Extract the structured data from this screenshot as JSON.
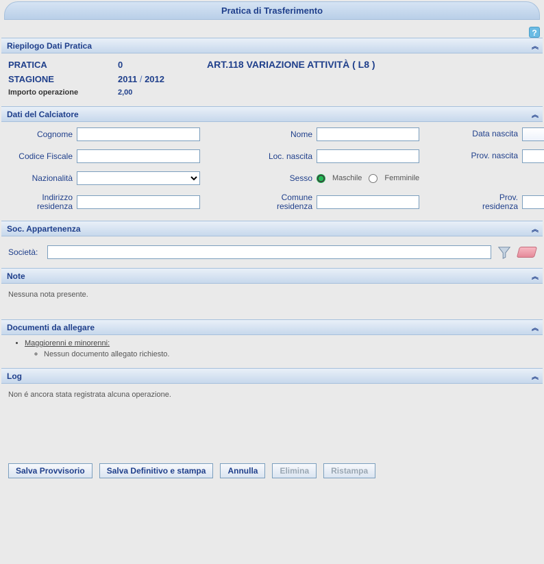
{
  "page_title": "Pratica di Trasferimento",
  "help_label": "?",
  "sections": {
    "riepilogo": {
      "title": "Riepilogo Dati Pratica"
    },
    "calciatore": {
      "title": "Dati del Calciatore"
    },
    "societa": {
      "title": "Soc. Appartenenza"
    },
    "note": {
      "title": "Note"
    },
    "documenti": {
      "title": "Documenti da allegare"
    },
    "log": {
      "title": "Log"
    }
  },
  "summary": {
    "pratica_label": "PRATICA",
    "pratica_value": "0",
    "art_label": "ART.118 VARIAZIONE ATTIVITÀ  ( L8 )",
    "stagione_label": "STAGIONE",
    "stagione_start": "2011",
    "stagione_sep": "/",
    "stagione_end": "2012",
    "importo_label": "Importo operazione",
    "importo_value": "2,00"
  },
  "calciatore": {
    "cognome_label": "Cognome",
    "nome_label": "Nome",
    "data_nascita_label": "Data nascita",
    "codice_fiscale_label": "Codice Fiscale",
    "loc_nascita_label": "Loc. nascita",
    "prov_nascita_label": "Prov. nascita",
    "nazionalita_label": "Nazionalità",
    "sesso_label": "Sesso",
    "sesso_m": "Maschile",
    "sesso_f": "Femminile",
    "indirizzo_label": "Indirizzo residenza",
    "comune_label": "Comune residenza",
    "prov_res_label": "Prov. residenza",
    "cognome_value": "",
    "nome_value": "",
    "codice_fiscale_value": "",
    "loc_nascita_value": "",
    "prov_nascita_value": "",
    "indirizzo_value": "",
    "comune_value": "",
    "prov_res_value": ""
  },
  "societa": {
    "label": "Società:",
    "value": ""
  },
  "note_text": "Nessuna nota presente.",
  "documenti": {
    "group": "Maggiorenni e minorenni:",
    "item": "Nessun documento allegato richiesto."
  },
  "log_text": "Non é ancora stata registrata alcuna operazione.",
  "buttons": {
    "salva_provvisorio": "Salva Provvisorio",
    "salva_definitivo": "Salva Definitivo e stampa",
    "annulla": "Annulla",
    "elimina": "Elimina",
    "ristampa": "Ristampa"
  }
}
